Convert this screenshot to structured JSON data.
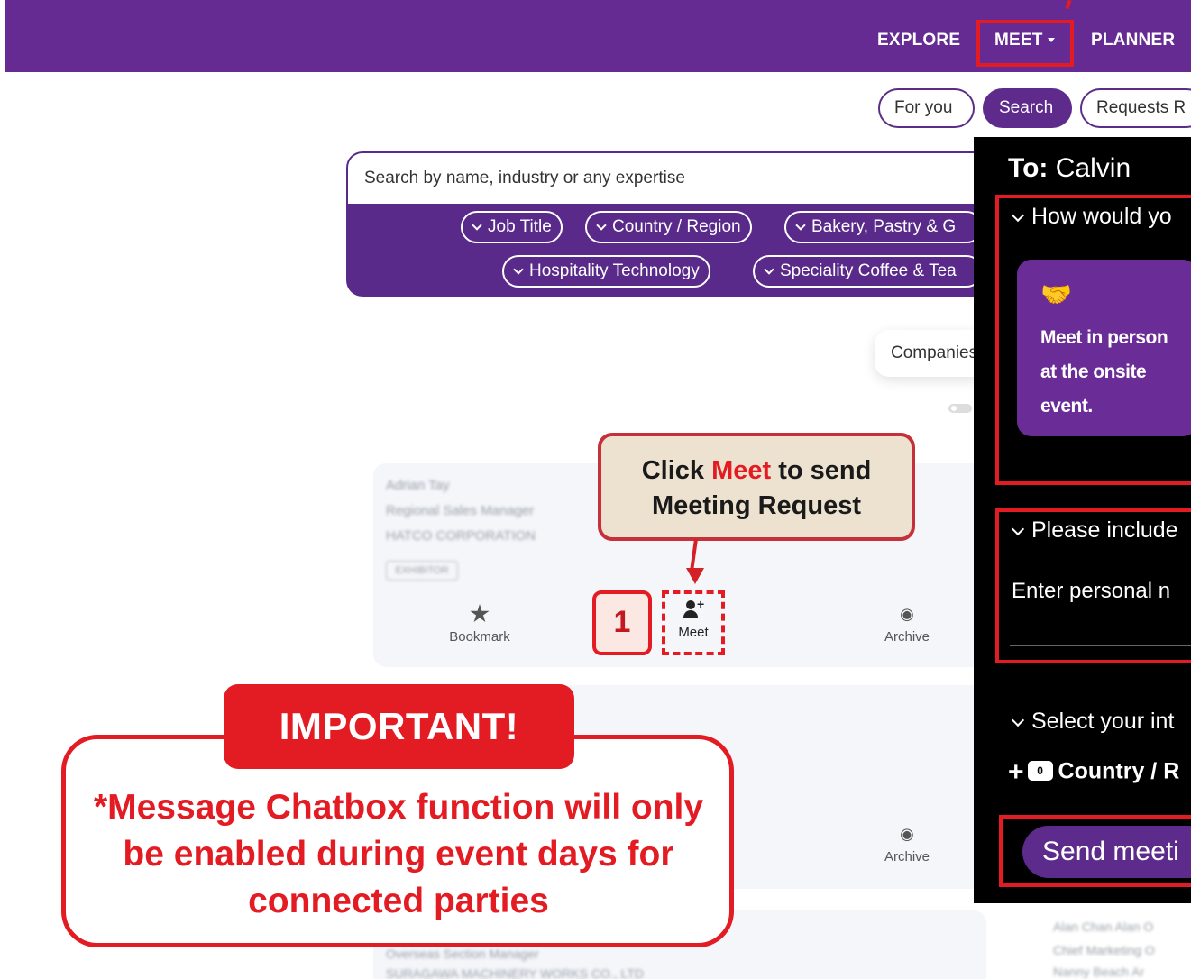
{
  "nav": {
    "items": [
      {
        "label": "EXPLORE"
      },
      {
        "label": "MEET"
      },
      {
        "label": "PLANNER"
      }
    ]
  },
  "pills": {
    "for_you": "For you",
    "search": "Search",
    "requests": "Requests R"
  },
  "search": {
    "placeholder": "Search by name, industry or any expertise",
    "filters": [
      "Job Title",
      "Country / Region",
      "Bakery, Pastry & G",
      "Hospitality Technology",
      "Speciality Coffee & Tea"
    ]
  },
  "companies_tab": "Companies",
  "cards": [
    {
      "name": "Adrian Tay",
      "title": "Regional Sales Manager",
      "company": "HATCO CORPORATION",
      "tag": "EXHIBITOR",
      "actions": {
        "bookmark": "Bookmark",
        "meet": "Meet",
        "archive": "Archive"
      }
    },
    {
      "actions": {
        "archive": "Archive"
      }
    }
  ],
  "bottom_blur": {
    "left_line1": "Overseas Section Manager",
    "left_line2": "SURAGAWA MACHINERY WORKS CO., LTD",
    "right_line1": "Alan Chan Alan O",
    "right_line2": "Chief Marketing O",
    "right_line3": "Nanny Beach Ar"
  },
  "callout": {
    "line1_pre": "Click ",
    "line1_highlight": "Meet",
    "line1_post": " to send",
    "line2": "Meeting Request",
    "step_number": "1"
  },
  "important": {
    "title": "IMPORTANT!",
    "message": "*Message Chatbox function will only be enabled during event days for connected parties"
  },
  "meeting_panel": {
    "to_label": "To:",
    "to_name": "Calvin",
    "q1": "How would yo",
    "option_text": "Meet in person at the onsite event.",
    "q2": "Please include",
    "note_placeholder": "Enter personal n",
    "q3": "Select your int",
    "interest_count": "0",
    "interest_label": "Country / R",
    "send_button": "Send meeti"
  },
  "colors": {
    "brand_purple": "#652b92",
    "highlight_red": "#e31b23",
    "callout_beige": "#ece2cf"
  }
}
